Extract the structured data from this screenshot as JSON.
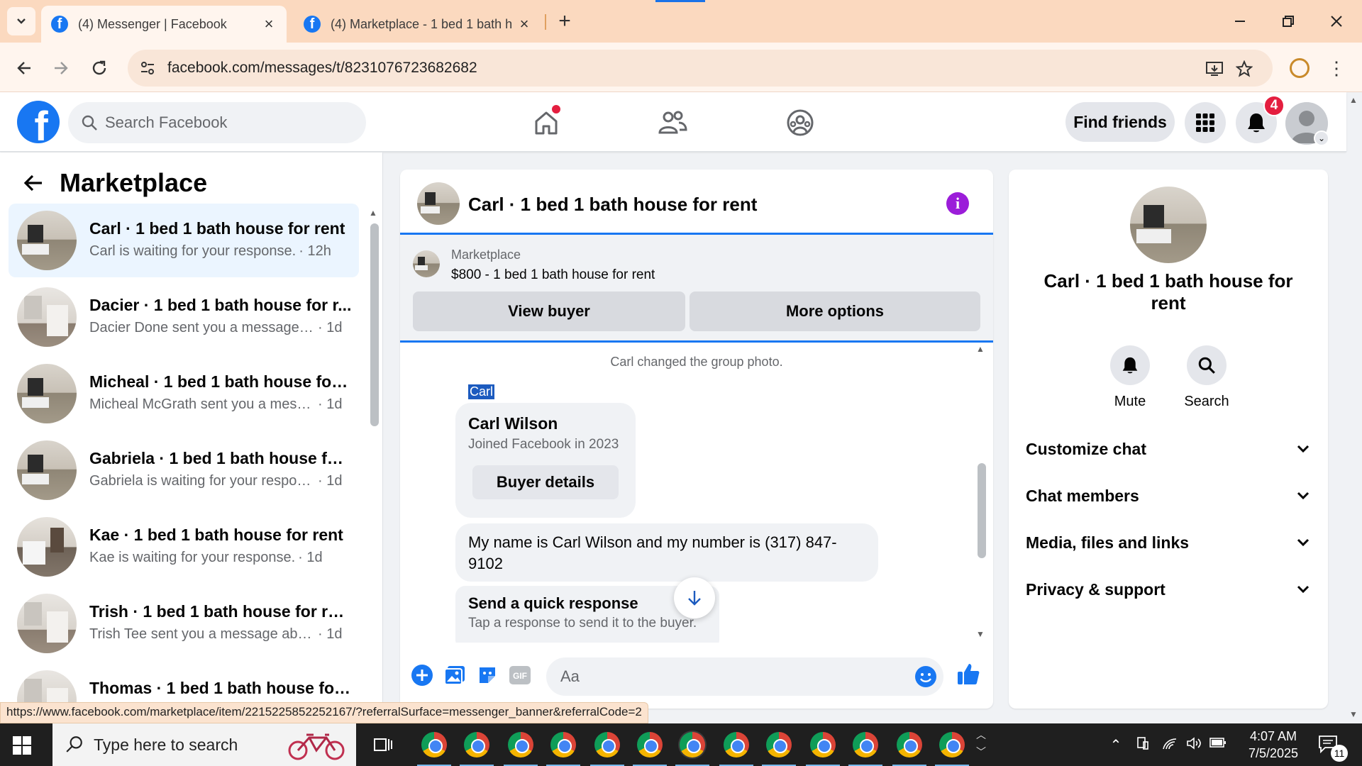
{
  "browser": {
    "tabs": [
      {
        "title": "(4) Messenger | Facebook",
        "active": true
      },
      {
        "title": "(4) Marketplace - 1 bed 1 bath h",
        "active": false
      }
    ],
    "url": "facebook.com/messages/t/8231076723682682"
  },
  "fb_header": {
    "logo": "f",
    "search_placeholder": "Search Facebook",
    "find_friends_label": "Find friends",
    "notification_count": "4"
  },
  "sidebar": {
    "title": "Marketplace",
    "conversations": [
      {
        "name": "Carl · 1 bed 1 bath house for rent",
        "preview": "Carl is waiting for your response.",
        "time": "· 12h",
        "selected": true
      },
      {
        "name": "Dacier · 1 bed 1 bath house for r...",
        "preview": "Dacier Done sent you a message a...",
        "time": "· 1d",
        "selected": false
      },
      {
        "name": "Micheal · 1 bed 1 bath house for ...",
        "preview": "Micheal McGrath sent you a messa...",
        "time": "· 1d",
        "selected": false
      },
      {
        "name": "Gabriela · 1 bed 1 bath house for...",
        "preview": "Gabriela is waiting for your respon...",
        "time": "· 1d",
        "selected": false
      },
      {
        "name": "Kae · 1 bed 1 bath house for rent",
        "preview": "Kae is waiting for your response.",
        "time": "· 1d",
        "selected": false
      },
      {
        "name": "Trish · 1 bed 1 bath house for rent",
        "preview": "Trish Tee sent you a message about...",
        "time": "· 1d",
        "selected": false
      },
      {
        "name": "Thomas · 1 bed 1 bath house for ...",
        "preview": "",
        "time": "",
        "selected": false
      }
    ]
  },
  "chat": {
    "title": "Carl · 1 bed 1 bath house for rent",
    "listing": {
      "kind": "Marketplace",
      "title": "$800 - 1 bed 1 bath house for rent",
      "view_buyer_label": "View buyer",
      "more_options_label": "More options"
    },
    "system_message": "Carl changed the group photo.",
    "sender_label": "Carl",
    "profile_card": {
      "name": "Carl Wilson",
      "joined": "Joined Facebook in 2023",
      "button_label": "Buyer details"
    },
    "message": "My name is Carl Wilson and my number is (317) 847-9102",
    "quick_response": {
      "title": "Send a quick response",
      "subtitle": "Tap a response to send it to the buyer."
    },
    "composer_placeholder": "Aa"
  },
  "info_panel": {
    "name": "Carl · 1 bed 1 bath house for rent",
    "actions": [
      {
        "label": "Mute",
        "icon": "bell-icon"
      },
      {
        "label": "Search",
        "icon": "search-icon"
      }
    ],
    "sections": [
      "Customize chat",
      "Chat members",
      "Media, files and links",
      "Privacy & support"
    ]
  },
  "status_url": "https://www.facebook.com/marketplace/item/2215225852252167/?referralSurface=messenger_banner&referralCode=2",
  "taskbar": {
    "search_placeholder": "Type here to search",
    "time": "4:07 AM",
    "date": "7/5/2025",
    "notification_count": "11"
  },
  "colors": {
    "fb_blue": "#1877f2",
    "tab_bar": "#fbd9bf",
    "badge_red": "#e41e3f",
    "info_purple": "#9b1dd9"
  }
}
